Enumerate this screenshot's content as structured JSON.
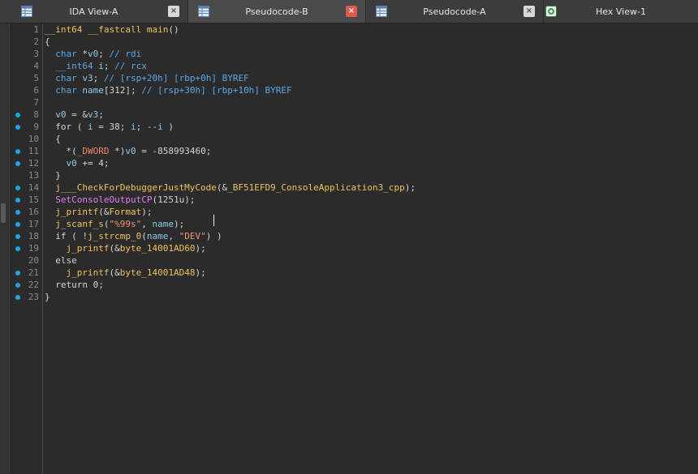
{
  "tabs": [
    {
      "label": "IDA View-A",
      "active": false,
      "icon": "table-icon"
    },
    {
      "label": "Pseudocode-B",
      "active": true,
      "icon": "table-icon"
    },
    {
      "label": "Pseudocode-A",
      "active": false,
      "icon": "table-icon"
    },
    {
      "label": "Hex View-1",
      "active": false,
      "icon": "hex-view-icon"
    }
  ],
  "close_glyph": "×",
  "colors": {
    "accent_breakpoint": "#1ea7e8",
    "active_close": "#e05a4a",
    "keyword": "#f0c35a",
    "type": "#5aa9e6",
    "string": "#f09470",
    "api_call": "#e07ef0"
  },
  "code": {
    "lines": [
      {
        "n": "1",
        "bp": false,
        "segs": [
          [
            "fn",
            "__int64 __fastcall main"
          ],
          [
            "pl",
            "()"
          ]
        ]
      },
      {
        "n": "2",
        "bp": false,
        "segs": [
          [
            "pl",
            "{"
          ]
        ]
      },
      {
        "n": "3",
        "bp": false,
        "segs": [
          [
            "ty",
            "  char"
          ],
          [
            "pl",
            " *"
          ],
          [
            "var",
            "v0"
          ],
          [
            "pl",
            "; "
          ],
          [
            "cm",
            "// rdi"
          ]
        ]
      },
      {
        "n": "4",
        "bp": false,
        "segs": [
          [
            "ty",
            "  __int64"
          ],
          [
            "pl",
            " "
          ],
          [
            "var",
            "i"
          ],
          [
            "pl",
            "; "
          ],
          [
            "cm",
            "// rcx"
          ]
        ]
      },
      {
        "n": "5",
        "bp": false,
        "segs": [
          [
            "ty",
            "  char"
          ],
          [
            "pl",
            " "
          ],
          [
            "var",
            "v3"
          ],
          [
            "pl",
            "; "
          ],
          [
            "cm",
            "// [rsp+20h] [rbp+0h] BYREF"
          ]
        ]
      },
      {
        "n": "6",
        "bp": false,
        "segs": [
          [
            "ty",
            "  char"
          ],
          [
            "pl",
            " "
          ],
          [
            "var",
            "name"
          ],
          [
            "pl",
            "[312]; "
          ],
          [
            "cm",
            "// [rsp+30h] [rbp+10h] BYREF"
          ]
        ]
      },
      {
        "n": "7",
        "bp": false,
        "segs": [
          [
            "pl",
            ""
          ]
        ]
      },
      {
        "n": "8",
        "bp": true,
        "segs": [
          [
            "pl",
            "  "
          ],
          [
            "var",
            "v0"
          ],
          [
            "pl",
            " = &"
          ],
          [
            "var",
            "v3"
          ],
          [
            "pl",
            ";"
          ]
        ]
      },
      {
        "n": "9",
        "bp": true,
        "segs": [
          [
            "pl",
            "  for ( "
          ],
          [
            "var",
            "i"
          ],
          [
            "pl",
            " = 38; "
          ],
          [
            "var",
            "i"
          ],
          [
            "pl",
            "; --"
          ],
          [
            "var",
            "i"
          ],
          [
            "pl",
            " )"
          ]
        ]
      },
      {
        "n": "10",
        "bp": false,
        "segs": [
          [
            "pl",
            "  {"
          ]
        ]
      },
      {
        "n": "11",
        "bp": true,
        "segs": [
          [
            "pl",
            "    *("
          ],
          [
            "dw",
            "_DWORD"
          ],
          [
            "pl",
            " *)"
          ],
          [
            "var",
            "v0"
          ],
          [
            "pl",
            " = -858993460;"
          ]
        ]
      },
      {
        "n": "12",
        "bp": true,
        "segs": [
          [
            "pl",
            "    "
          ],
          [
            "var",
            "v0"
          ],
          [
            "pl",
            " += 4;"
          ]
        ]
      },
      {
        "n": "13",
        "bp": false,
        "segs": [
          [
            "pl",
            "  }"
          ]
        ]
      },
      {
        "n": "14",
        "bp": true,
        "segs": [
          [
            "fn",
            "  j___CheckForDebuggerJustMyCode"
          ],
          [
            "pl",
            "(&"
          ],
          [
            "fn",
            "_BF51EFD9_ConsoleApplication3_cpp"
          ],
          [
            "pl",
            ");"
          ]
        ]
      },
      {
        "n": "15",
        "bp": true,
        "segs": [
          [
            "fn2",
            "  SetConsoleOutputCP"
          ],
          [
            "pl",
            "(1251u);"
          ]
        ]
      },
      {
        "n": "16",
        "bp": true,
        "segs": [
          [
            "fn",
            "  j_printf"
          ],
          [
            "pl",
            "(&"
          ],
          [
            "fn",
            "Format"
          ],
          [
            "pl",
            ");"
          ]
        ]
      },
      {
        "n": "17",
        "bp": true,
        "segs": [
          [
            "fn",
            "  j_scanf_s"
          ],
          [
            "pl",
            "("
          ],
          [
            "str",
            "\"%99s\""
          ],
          [
            "pl",
            ", "
          ],
          [
            "var",
            "name"
          ],
          [
            "pl",
            ");"
          ]
        ]
      },
      {
        "n": "18",
        "bp": true,
        "segs": [
          [
            "pl",
            "  if ( !"
          ],
          [
            "fn",
            "j_strcmp_0"
          ],
          [
            "pl",
            "("
          ],
          [
            "var",
            "name"
          ],
          [
            "pl",
            ", "
          ],
          [
            "str",
            "\"DEV\""
          ],
          [
            "pl",
            ") )"
          ]
        ]
      },
      {
        "n": "19",
        "bp": true,
        "segs": [
          [
            "fn",
            "    j_printf"
          ],
          [
            "pl",
            "(&"
          ],
          [
            "fn",
            "byte_14001AD60"
          ],
          [
            "pl",
            ");"
          ]
        ]
      },
      {
        "n": "20",
        "bp": false,
        "segs": [
          [
            "pl",
            "  else"
          ]
        ]
      },
      {
        "n": "21",
        "bp": true,
        "segs": [
          [
            "fn",
            "    j_printf"
          ],
          [
            "pl",
            "(&"
          ],
          [
            "fn",
            "byte_14001AD48"
          ],
          [
            "pl",
            ");"
          ]
        ]
      },
      {
        "n": "22",
        "bp": true,
        "segs": [
          [
            "pl",
            "  return 0;"
          ]
        ]
      },
      {
        "n": "23",
        "bp": true,
        "segs": [
          [
            "pl",
            "}"
          ]
        ]
      }
    ]
  }
}
